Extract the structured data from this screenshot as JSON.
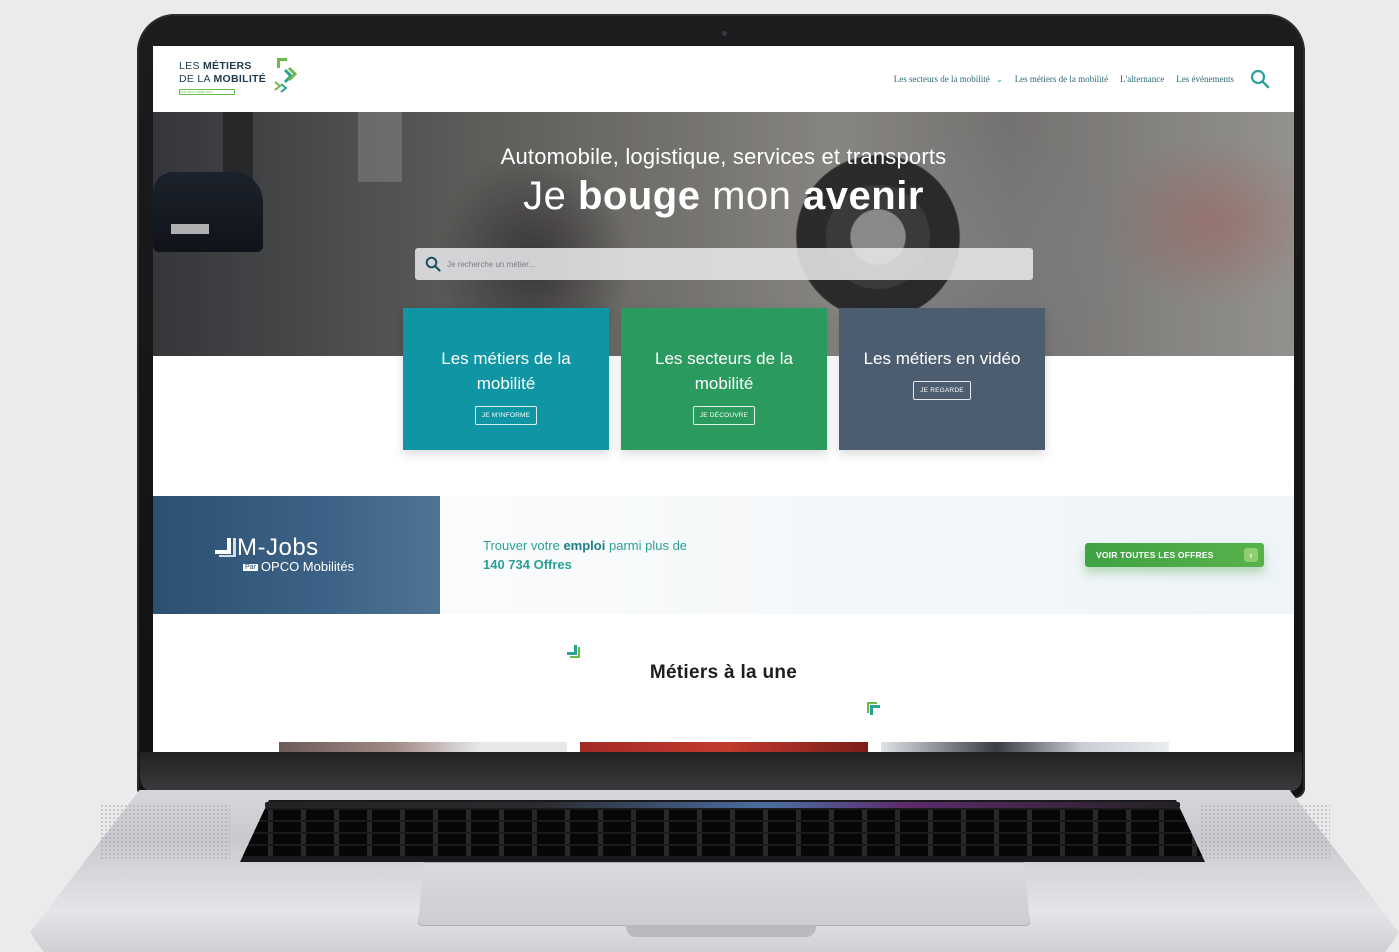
{
  "header": {
    "logo": {
      "line1_prefix": "LES",
      "line1_bold": "MÉTIERS",
      "line2_prefix": "DE LA",
      "line2_bold": "MOBILITÉ",
      "badge": "PAR OPCO MOBILITÉS"
    },
    "nav": [
      {
        "label": "Les secteurs de la mobilité",
        "has_dropdown": true
      },
      {
        "label": "Les métiers de la mobilité"
      },
      {
        "label": "L'alternance"
      },
      {
        "label": "Les événements"
      }
    ],
    "search_icon": "search-icon"
  },
  "hero": {
    "subtitle": "Automobile, logistique, services et transports",
    "title_part1": "Je",
    "title_bold1": "bouge",
    "title_part2": "mon",
    "title_bold2": "avenir",
    "search_placeholder": "Je recherche un métier..."
  },
  "cards": [
    {
      "title": "Les métiers de la mobilité",
      "button": "JE M'INFORME",
      "color": "#0f95a3"
    },
    {
      "title": "Les secteurs de la mobilité",
      "button": "JE DÉCOUVRE",
      "color": "#2b9a5e"
    },
    {
      "title": "Les métiers en vidéo",
      "button": "JE REGARDE",
      "color": "#4b5d6f"
    }
  ],
  "mjobs": {
    "name": "M-Jobs",
    "par": "Par",
    "org": "OPCO Mobilités",
    "text_prefix": "Trouver votre",
    "text_bold": "emploi",
    "text_suffix": "parmi plus de",
    "offers_count": "140 734 Offres",
    "button_label": "VOIR TOUTES LES OFFRES",
    "button_arrow": "›"
  },
  "featured": {
    "title": "Métiers à la une"
  },
  "colors": {
    "teal": "#2aa197",
    "green": "#58b24a",
    "navy": "#2d5072"
  }
}
